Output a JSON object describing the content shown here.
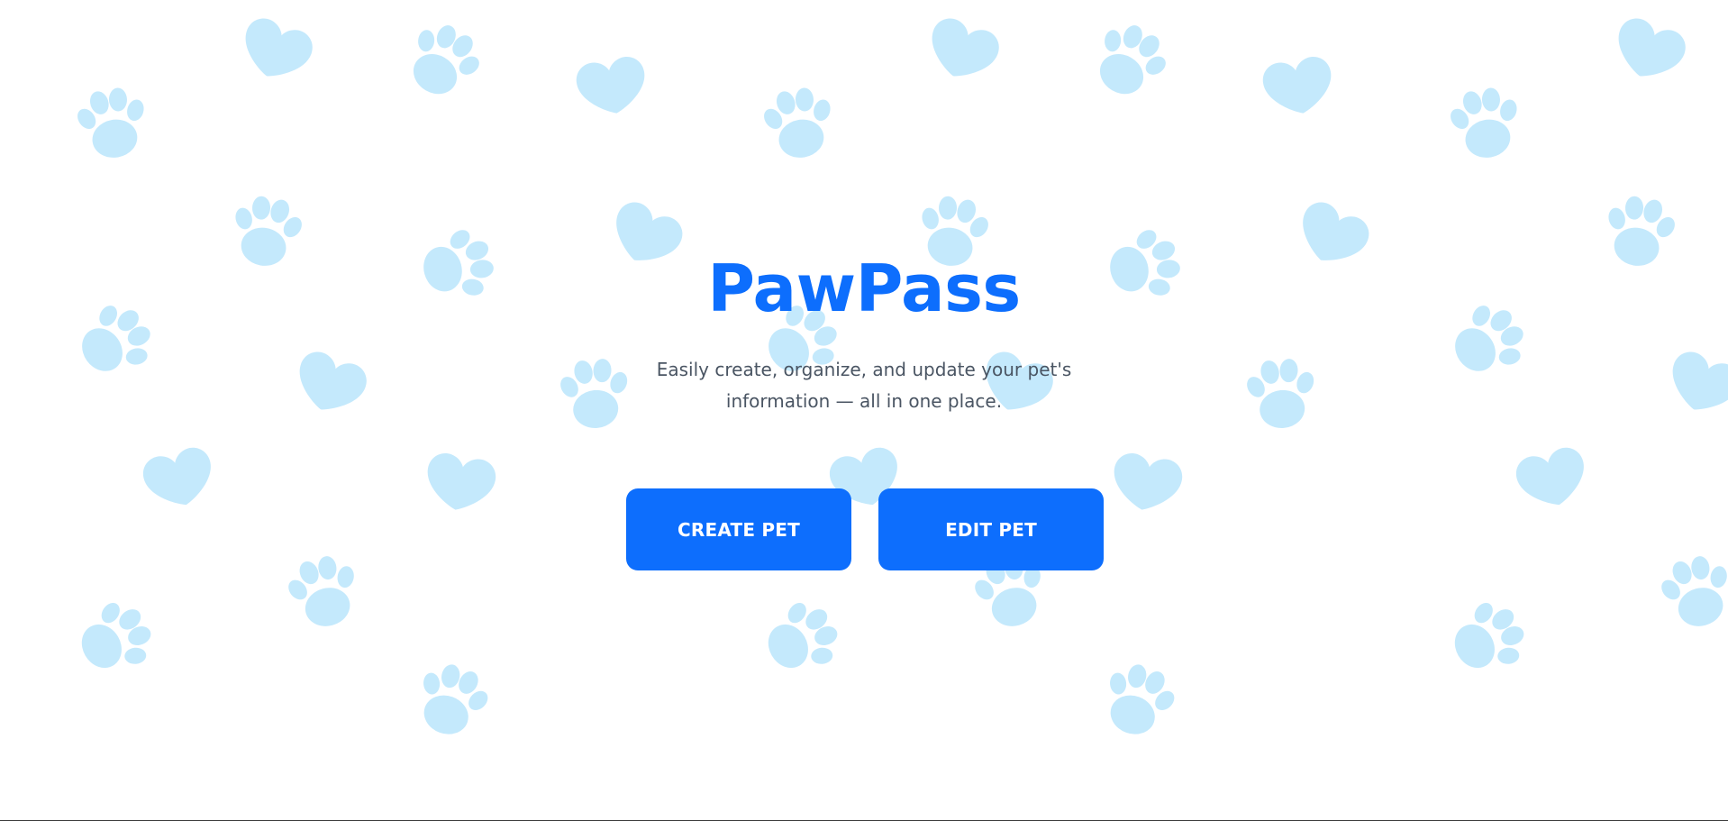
{
  "app": {
    "title": "PawPass",
    "subtitle": "Easily create, organize, and update your pet's information — all in one place."
  },
  "actions": {
    "create_label": "CREATE PET",
    "edit_label": "EDIT PET"
  },
  "background": {
    "pattern_icon": "paw-print-icon"
  },
  "colors": {
    "accent": "#0d6efd",
    "paw": "#c4e9fc",
    "text_muted": "#4a5563",
    "background": "#ffffff"
  }
}
